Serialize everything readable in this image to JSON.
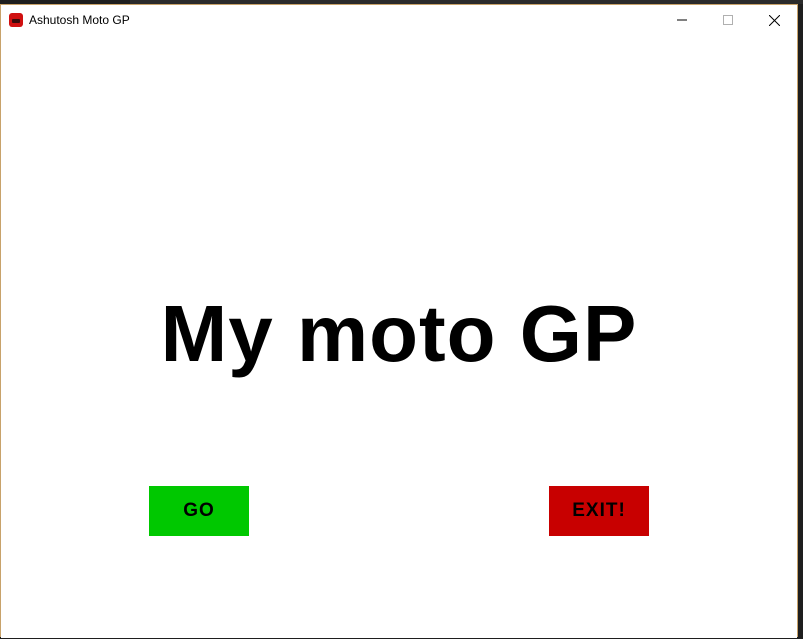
{
  "window": {
    "title": "Ashutosh Moto GP",
    "icon": "app-car-icon",
    "controls": [
      "minimize-icon",
      "maximize-icon",
      "close-icon"
    ]
  },
  "main": {
    "heading": "My moto GP"
  },
  "buttons": {
    "go_label": "GO",
    "go_color": "#00c800",
    "exit_label": "EXIT!",
    "exit_color": "#c80000"
  }
}
